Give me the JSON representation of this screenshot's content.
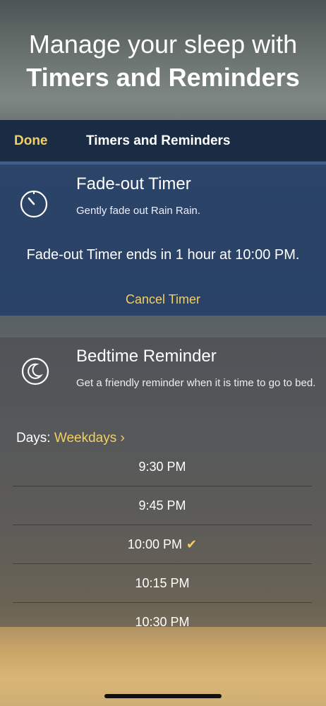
{
  "hero": {
    "line1": "Manage your sleep with",
    "line2": "Timers and Reminders"
  },
  "navbar": {
    "done_label": "Done",
    "title": "Timers and Reminders"
  },
  "fade_timer": {
    "icon": "timer-icon",
    "title": "Fade-out Timer",
    "subtitle": "Gently fade out Rain Rain.",
    "status": "Fade-out Timer ends in 1 hour at 10:00 PM.",
    "cancel_label": "Cancel Timer"
  },
  "bedtime": {
    "icon": "moon-icon",
    "title": "Bedtime Reminder",
    "subtitle": "Get a friendly reminder when it is time to go to bed.",
    "days_label": "Days:",
    "days_value": "Weekdays ›",
    "times": [
      {
        "label": "9:30 PM",
        "selected": false
      },
      {
        "label": "9:45 PM",
        "selected": false
      },
      {
        "label": "10:00 PM",
        "selected": true
      },
      {
        "label": "10:15 PM",
        "selected": false
      },
      {
        "label": "10:30 PM",
        "selected": false
      }
    ],
    "check_glyph": "✔"
  },
  "colors": {
    "accent": "#f2cf63",
    "navbar": "#122640",
    "fade_panel": "#223e66"
  }
}
